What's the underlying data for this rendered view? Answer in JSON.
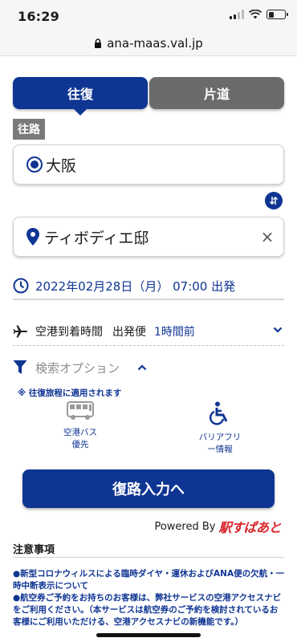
{
  "status": {
    "time": "16:29"
  },
  "browser": {
    "url": "ana-maas.val.jp"
  },
  "tabs": {
    "roundtrip": "往復",
    "oneway": "片道"
  },
  "outbound_label": "往路",
  "origin": {
    "value": "大阪"
  },
  "destination": {
    "value": "ティボディエ邸",
    "clear": "×"
  },
  "datetime": "2022年02月28日（月） 07:00 出発",
  "airport": {
    "label": "空港到着時間",
    "direction": "出発便",
    "time": "1時間前"
  },
  "options": {
    "label": "検索オプション",
    "note": "※ 往復旅程に適用されます",
    "bus": {
      "line1": "空港バス",
      "line2": "優先"
    },
    "barrier_free": {
      "line1": "バリアフリ",
      "line2": "ー情報"
    }
  },
  "return_button": "復路入力へ",
  "powered": {
    "text": "Powered By",
    "brand": "駅すぱあと"
  },
  "notes": {
    "title": "注意事項",
    "items": [
      "●新型コロナウィルスによる臨時ダイヤ・運休およびANA便の欠航・一時中断表示について",
      "●航空券ご予約をお持ちのお客様は、弊社サービスの空港アクセスナビをご利用ください。（本サービスは航空券のご予約を検討されているお客様にご利用いただける、空港アクセスナビの新機能です。）"
    ]
  },
  "colors": {
    "primary": "#0f3593",
    "tab_inactive": "#6b6b6b",
    "brand_red": "#d8262e"
  }
}
